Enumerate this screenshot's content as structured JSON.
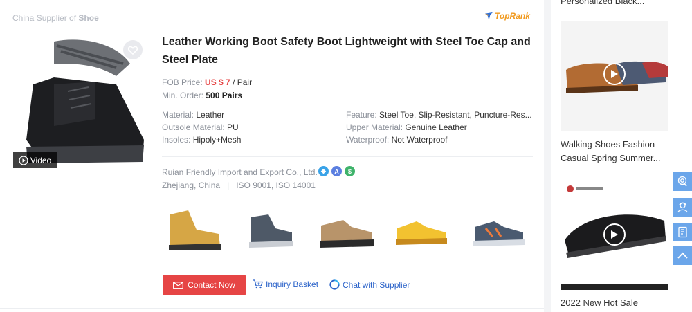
{
  "header": {
    "supplier_prefix": "China Supplier of",
    "supplier_keyword": "Shoe",
    "toprank_label": "TopRank"
  },
  "product": {
    "video_label": "Video",
    "title": "Leather Working Boot Safety Boot Lightweight with Steel Toe Cap and Steel Plate",
    "fob_label": "FOB Price:",
    "price": "US $ 7",
    "price_unit": "/ Pair",
    "moq_label": "Min. Order:",
    "moq": "500 Pairs",
    "attributes": [
      {
        "label": "Material:",
        "value": "Leather"
      },
      {
        "label": "Outsole Material:",
        "value": "PU"
      },
      {
        "label": "Insoles:",
        "value": "Hipoly+Mesh"
      },
      {
        "label": "Feature:",
        "value": "Steel Toe, Slip-Resistant, Puncture-Res..."
      },
      {
        "label": "Upper Material:",
        "value": "Genuine Leather"
      },
      {
        "label": "Waterproof:",
        "value": "Not Waterproof"
      }
    ],
    "company": "Ruian Friendly Import and Export Co., Ltd.",
    "location": "Zhejiang, China",
    "certifications": "ISO 9001, ISO 14001"
  },
  "actions": {
    "contact_label": "Contact Now",
    "inquiry_label": "Inquiry Basket",
    "chat_label": "Chat with Supplier"
  },
  "sidebar": {
    "top_caption": "Personalized Black...",
    "items": [
      {
        "caption_line1": "Walking Shoes Fashion",
        "caption_line2": "Casual Spring Summer..."
      },
      {
        "caption_line1": "2022 New Hot Sale",
        "caption_line2": ""
      }
    ]
  },
  "icons": {
    "heart": "heart-icon",
    "video": "play-circle-icon",
    "mail": "mail-icon",
    "cart": "cart-icon",
    "chat": "chat-icon"
  },
  "colors": {
    "accent_red": "#e64545",
    "link_blue": "#2a62c9",
    "toprank_orange": "#f19a1f",
    "float_blue": "#6ba6ea"
  }
}
